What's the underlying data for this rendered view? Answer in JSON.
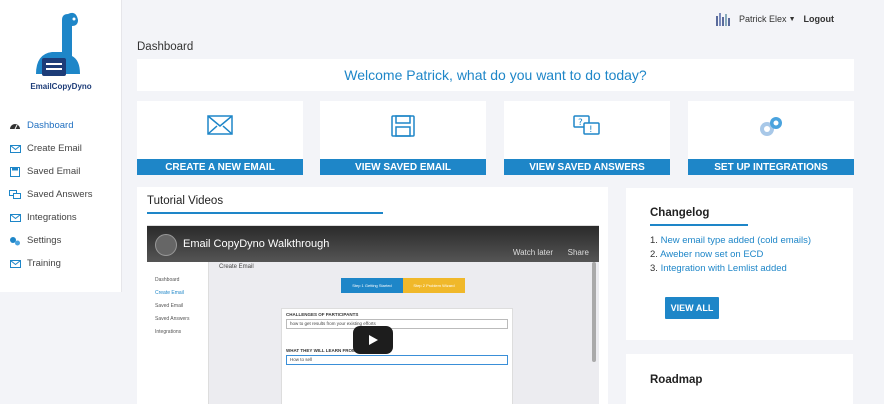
{
  "app": {
    "logo_text": "EmailCopyDyno"
  },
  "sidebar": {
    "items": [
      {
        "label": "Dashboard",
        "icon": "dashboard-icon"
      },
      {
        "label": "Create Email",
        "icon": "envelope-icon"
      },
      {
        "label": "Saved Email",
        "icon": "floppy-icon"
      },
      {
        "label": "Saved Answers",
        "icon": "chat-icon"
      },
      {
        "label": "Integrations",
        "icon": "envelope-icon"
      },
      {
        "label": "Settings",
        "icon": "gears-icon"
      },
      {
        "label": "Training",
        "icon": "envelope-icon"
      }
    ]
  },
  "topbar": {
    "user": "Patrick Elex",
    "logout": "Logout"
  },
  "page": {
    "title": "Dashboard",
    "welcome": "Welcome Patrick, what do you want to do today?"
  },
  "cards": [
    {
      "label": "CREATE A NEW EMAIL",
      "icon": "envelope-icon"
    },
    {
      "label": "VIEW SAVED EMAIL",
      "icon": "floppy-icon"
    },
    {
      "label": "VIEW SAVED ANSWERS",
      "icon": "chat-icon"
    },
    {
      "label": "SET UP INTEGRATIONS",
      "icon": "gears-icon"
    }
  ],
  "tutorial": {
    "title": "Tutorial Videos",
    "video": {
      "title": "Email CopyDyno Walkthrough",
      "watch_later": "Watch later",
      "share": "Share",
      "page_title": "Create Email",
      "steps": [
        "Step 1 Getting Started",
        "Step 2 Problem Wizard"
      ],
      "sidebar": [
        "Dashboard",
        "Create Email",
        "Saved Email",
        "Saved Answers",
        "Integrations"
      ],
      "q1": "CHALLENGES OF PARTICIPANTS",
      "a1": "how to get results from your existing efforts",
      "q2": "WHAT THEY WILL LEARN FROM THE WEBINAR",
      "a2": "How to sell"
    }
  },
  "changelog": {
    "title": "Changelog",
    "items": [
      {
        "num": "1.",
        "text": "New email type added (cold emails)"
      },
      {
        "num": "2.",
        "text": "Aweber now set on ECD"
      },
      {
        "num": "3.",
        "text": "Integration with Lemlist added"
      }
    ],
    "button": "VIEW ALL"
  },
  "roadmap": {
    "title": "Roadmap"
  },
  "colors": {
    "accent": "#1e86c8",
    "brand_dark": "#1d3c78"
  }
}
